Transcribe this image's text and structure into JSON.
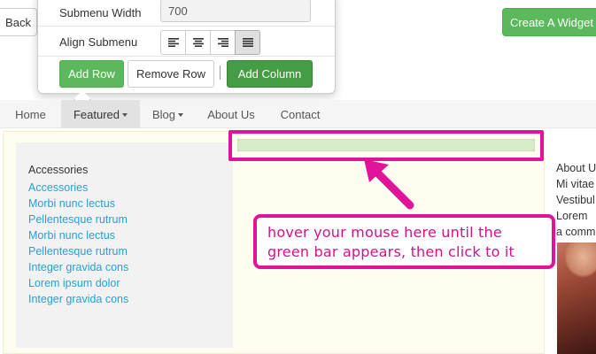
{
  "top": {
    "back_label": "Back",
    "create_widget_label": "Create A Widget"
  },
  "popover": {
    "submenu_width_label": "Submenu Width",
    "submenu_width_value": "700",
    "align_submenu_label": "Align Submenu",
    "align_options": [
      "align-left",
      "align-center",
      "align-right",
      "align-justify"
    ],
    "align_selected": "align-justify",
    "add_row_label": "Add Row",
    "remove_row_label": "Remove Row",
    "add_column_label": "Add Column"
  },
  "nav": {
    "items": [
      {
        "label": "Home"
      },
      {
        "label": "Featured",
        "active": true,
        "dropdown": true
      },
      {
        "label": "Blog",
        "dropdown": true
      },
      {
        "label": "About Us"
      },
      {
        "label": "Contact"
      }
    ]
  },
  "sidebar": {
    "title": "Accessories",
    "links": [
      "Accessories",
      "Morbi nunc lectus",
      "Pellentesque rutrum",
      "Morbi nunc lectus",
      "Pellentesque rutrum",
      "Integer gravida cons",
      "Lorem ipsum dolor",
      "Integer gravida cons"
    ]
  },
  "callout": {
    "text": "hover your mouse here until the green bar appears, then click to it"
  },
  "right_column": {
    "lines": [
      "About U",
      "Mi vitae",
      "Vestibul",
      "Lorem",
      "a comm"
    ]
  },
  "colors": {
    "accent_green": "#5cb85c",
    "highlight_magenta": "#e0149a",
    "link_blue": "#2a9fd6",
    "green_bar": "#d6ecc8"
  }
}
